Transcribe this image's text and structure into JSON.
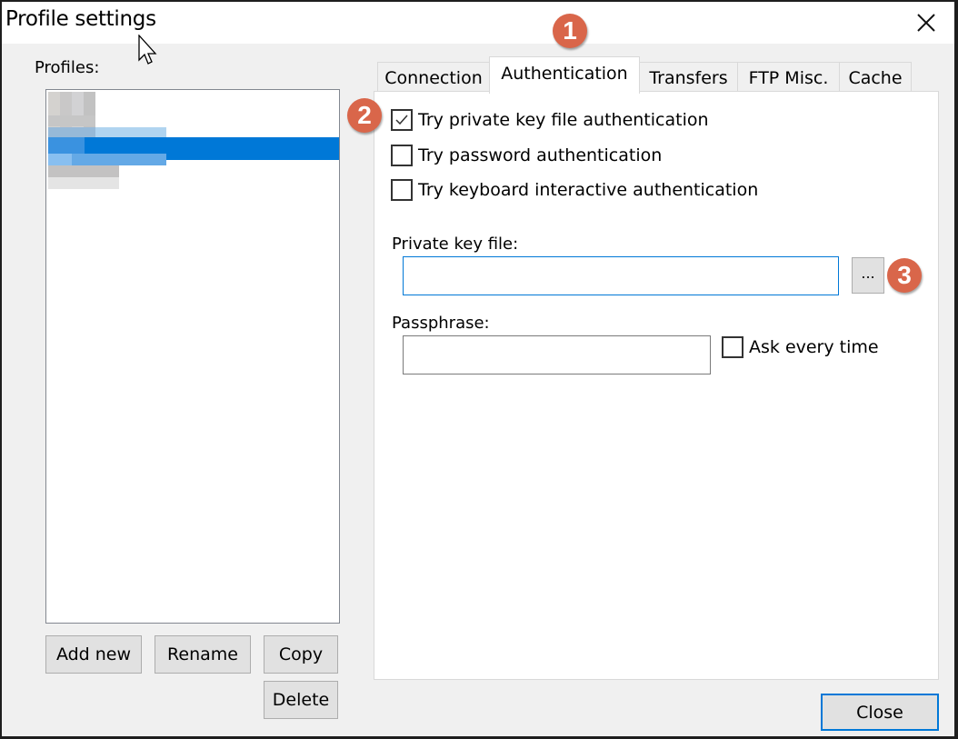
{
  "window": {
    "title": "Profile settings",
    "close_icon": "close-x-icon"
  },
  "profiles": {
    "label": "Profiles:",
    "items_redacted": true,
    "selected_index": 2
  },
  "profile_buttons": {
    "add_new": "Add new",
    "rename": "Rename",
    "copy": "Copy",
    "delete": "Delete"
  },
  "tabs": [
    {
      "label": "Connection",
      "active": false
    },
    {
      "label": "Authentication",
      "active": true
    },
    {
      "label": "Transfers",
      "active": false
    },
    {
      "label": "FTP Misc.",
      "active": false
    },
    {
      "label": "Cache",
      "active": false
    }
  ],
  "authentication": {
    "options": [
      {
        "label": "Try private key file authentication",
        "checked": true
      },
      {
        "label": "Try password authentication",
        "checked": false
      },
      {
        "label": "Try keyboard interactive authentication",
        "checked": false
      }
    ],
    "private_key_label": "Private key file:",
    "private_key_value": "",
    "browse_label": "...",
    "passphrase_label": "Passphrase:",
    "passphrase_value": "",
    "ask_every_time_label": "Ask every time",
    "ask_every_time_checked": false
  },
  "footer": {
    "close_label": "Close"
  },
  "annotations": [
    {
      "number": "1",
      "target": "Authentication tab"
    },
    {
      "number": "2",
      "target": "Try private key file authentication"
    },
    {
      "number": "3",
      "target": "Browse private key file button"
    }
  ],
  "colors": {
    "accent": "#0078d7",
    "badge": "#d9664a",
    "dialog_bg": "#f0f0f0"
  }
}
